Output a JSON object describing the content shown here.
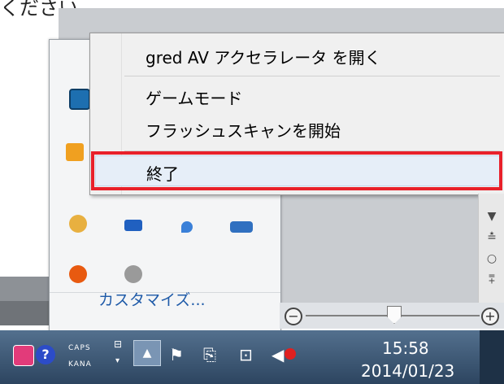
{
  "page_caption_fragment": "ください。",
  "context_menu": {
    "open_label": "gred AV アクセラレータ を開く",
    "game_mode_label": "ゲームモード",
    "flash_scan_label": "フラッシュスキャンを開始",
    "exit_label": "終了"
  },
  "tray_popup": {
    "customize_label": "カスタマイズ..."
  },
  "scrollbar": {
    "down": "▼",
    "up_double": "≛",
    "circle": "○",
    "down_double": "⩱"
  },
  "zoom": {
    "minus": "−",
    "plus": "+"
  },
  "taskbar": {
    "help_glyph": "?",
    "caps": "CAPS",
    "kana": "KANA",
    "ime_glyph1": "⊟",
    "ime_glyph2": "▾",
    "show_hidden": "▲",
    "flag": "⚑",
    "power": "⎘",
    "network": "⊡",
    "volume": "◀",
    "time": "15:58",
    "date": "2014/01/23"
  },
  "colors": {
    "highlight_border": "#e8202a",
    "taskbar_top": "#53708e",
    "taskbar_bottom": "#2d4560",
    "link_blue": "#1e5aa8"
  }
}
